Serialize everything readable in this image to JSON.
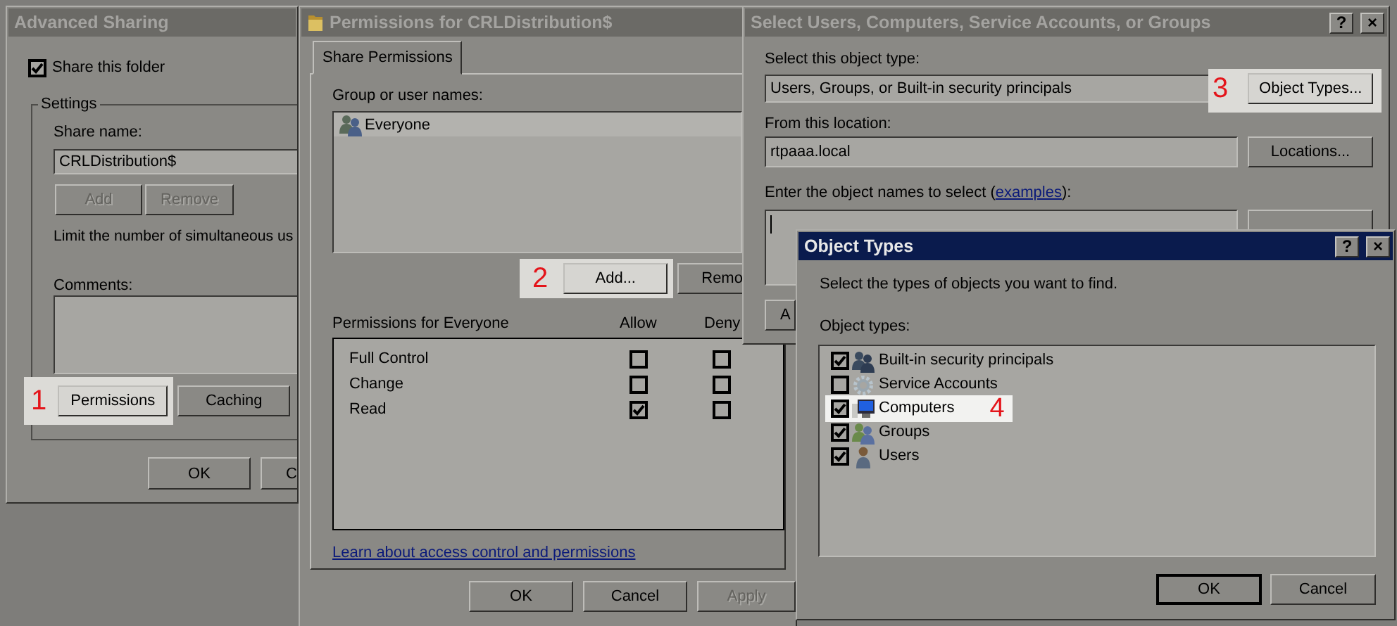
{
  "advanced_sharing": {
    "title": "Advanced Sharing",
    "active": false,
    "share_checkbox": {
      "label": "Share this folder",
      "checked": true
    },
    "settings_label": "Settings",
    "share_name_label": "Share name:",
    "share_name": "CRLDistribution$",
    "name_buttons": [
      {
        "label": "Add",
        "disabled": true
      },
      {
        "label": "Remove",
        "disabled": true
      }
    ],
    "limit_text": "Limit the number of simultaneous us",
    "comments_label": "Comments:",
    "step_badge": "1",
    "permissions_button": "Permissions",
    "caching_button": "Caching",
    "buttons": [
      {
        "label": "OK",
        "disabled": false
      },
      {
        "label": "C",
        "disabled": false
      }
    ]
  },
  "permissions": {
    "title": "Permissions for CRLDistribution$",
    "active": false,
    "tabs": [
      {
        "label": "Share Permissions",
        "selected": true
      }
    ],
    "group_label": "Group or user names:",
    "users": [
      {
        "name": "Everyone",
        "selected": true
      }
    ],
    "step_badge": "2",
    "add_button": "Add...",
    "remove_button": "Remo",
    "permissions_label": "Permissions for Everyone",
    "columns": [
      "Allow",
      "Deny"
    ],
    "rows": [
      {
        "name": "Full Control",
        "allow": false,
        "deny": false
      },
      {
        "name": "Change",
        "allow": false,
        "deny": false
      },
      {
        "name": "Read",
        "allow": true,
        "deny": false
      }
    ],
    "link": "Learn about access control and permissions",
    "buttons": [
      {
        "label": "OK",
        "disabled": false
      },
      {
        "label": "Cancel",
        "disabled": false
      },
      {
        "label": "Apply",
        "disabled": true
      }
    ]
  },
  "select_users": {
    "title": "Select Users, Computers, Service Accounts, or Groups",
    "active": false,
    "title_buttons": [
      "?",
      "×"
    ],
    "object_type_label": "Select this object type:",
    "object_type": "Users, Groups, or Built-in security principals",
    "step_badge": "3",
    "object_types_button": "Object Types...",
    "location_label": "From this location:",
    "location": "rtpaaa.local",
    "locations_button": "Locations...",
    "names_label_before": "Enter the object names to select (",
    "names_link": "examples",
    "names_label_after": "):",
    "advanced_button": "A"
  },
  "object_types": {
    "title": "Object Types",
    "active": true,
    "title_buttons": [
      "?",
      "×"
    ],
    "description": "Select the types of objects you want to find.",
    "list_label": "Object types:",
    "items": [
      {
        "name": "Built-in security principals",
        "checked": true
      },
      {
        "name": "Service Accounts",
        "checked": false
      },
      {
        "name": "Computers",
        "checked": true,
        "step_badge": "4"
      },
      {
        "name": "Groups",
        "checked": true
      },
      {
        "name": "Users",
        "checked": true
      }
    ],
    "buttons": [
      {
        "label": "OK",
        "default": true
      },
      {
        "label": "Cancel",
        "default": false
      }
    ]
  }
}
